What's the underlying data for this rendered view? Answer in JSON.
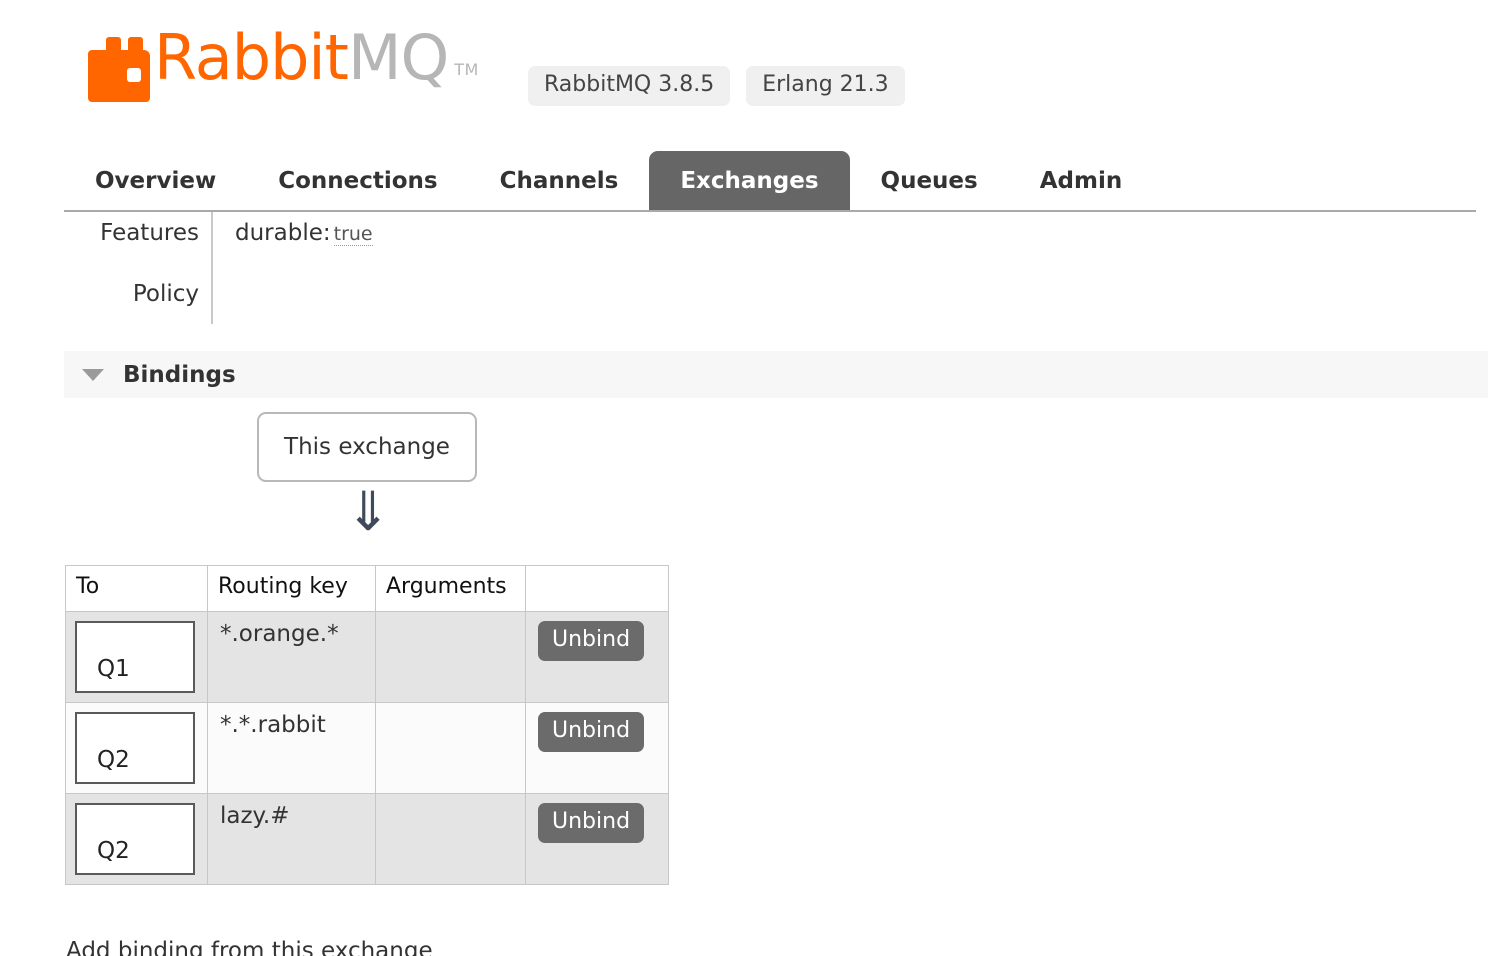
{
  "header": {
    "logo": {
      "name_part1": "Rabbit",
      "name_part2": "MQ",
      "trademark": "TM",
      "icon": "rabbitmq-logo-icon",
      "brand_color": "#ff6600",
      "secondary_color": "#b6b6b6"
    },
    "badges": [
      {
        "label": "RabbitMQ 3.8.5"
      },
      {
        "label": "Erlang 21.3"
      }
    ]
  },
  "nav": {
    "tabs": [
      {
        "label": "Overview",
        "active": false
      },
      {
        "label": "Connections",
        "active": false
      },
      {
        "label": "Channels",
        "active": false
      },
      {
        "label": "Exchanges",
        "active": true
      },
      {
        "label": "Queues",
        "active": false
      },
      {
        "label": "Admin",
        "active": false
      }
    ],
    "active_color": "#666666"
  },
  "details": {
    "features_label": "Features",
    "policy_label": "Policy",
    "features_key": "durable:",
    "features_value": "true",
    "policy_value": ""
  },
  "bindings_section": {
    "title": "Bindings",
    "caret": "chevron-down-icon",
    "exchange_node_label": "This exchange",
    "arrow_glyph": "⇓",
    "table": {
      "columns": [
        "To",
        "Routing key",
        "Arguments",
        ""
      ],
      "rows": [
        {
          "to": "Q1",
          "routing_key": "*.orange.*",
          "arguments": "",
          "action": "Unbind"
        },
        {
          "to": "Q2",
          "routing_key": "*.*.rabbit",
          "arguments": "",
          "action": "Unbind"
        },
        {
          "to": "Q2",
          "routing_key": "lazy.#",
          "arguments": "",
          "action": "Unbind"
        }
      ]
    }
  },
  "footer": {
    "add_binding_label": "Add binding from this exchange"
  }
}
